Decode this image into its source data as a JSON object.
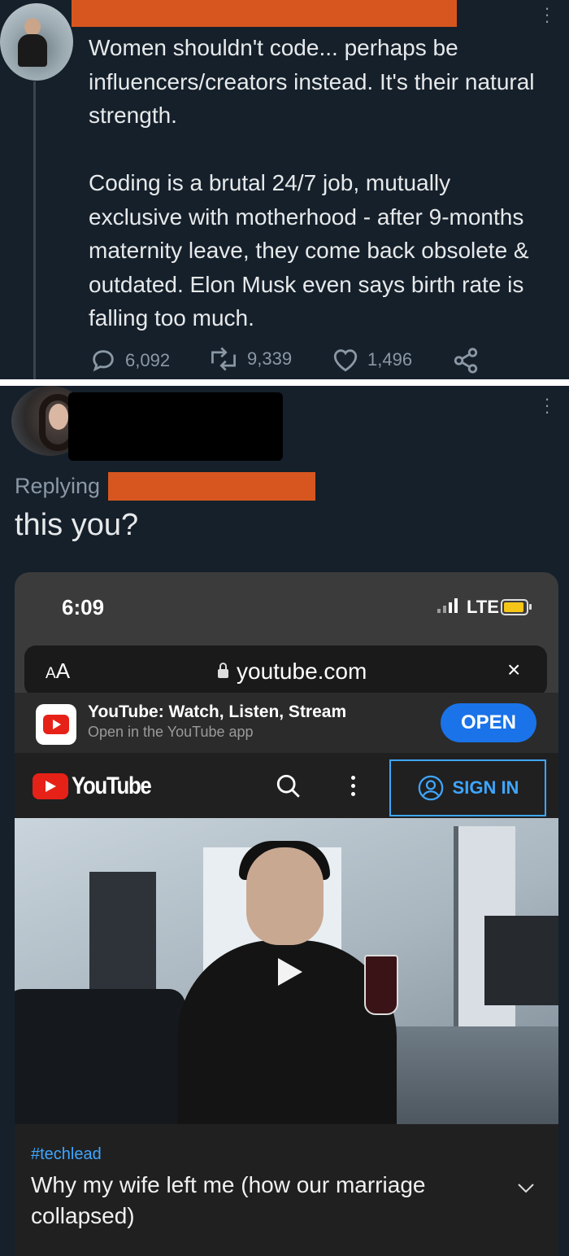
{
  "tweet1": {
    "text_p1": "Women shouldn't code... perhaps be influencers/creators instead. It's their natural strength.",
    "text_p2": "Coding is a brutal 24/7 job, mutually exclusive with motherhood - after 9-months maternity leave, they come back obsolete & outdated. Elon Musk even says birth rate is falling too much.",
    "replies": "6,092",
    "retweets": "9,339",
    "likes": "1,496"
  },
  "tweet2": {
    "replying_label": "Replying",
    "text": "this you?"
  },
  "phone": {
    "time": "6:09",
    "network": "LTE",
    "url": "youtube.com",
    "aa": "A",
    "aa_big": "A",
    "close": "×"
  },
  "app_banner": {
    "title": "YouTube: Watch, Listen, Stream",
    "subtitle": "Open in the YouTube app",
    "open_label": "OPEN"
  },
  "youtube": {
    "logo_text": "YouTube",
    "sign_in_label": "SIGN IN",
    "hashtag": "#techlead",
    "video_title": "Why my wife left me (how our marriage collapsed)"
  },
  "colors": {
    "bg": "#15202b",
    "redaction": "#d7561f",
    "yt_red": "#e62117",
    "link_blue": "#3ea6ff"
  }
}
